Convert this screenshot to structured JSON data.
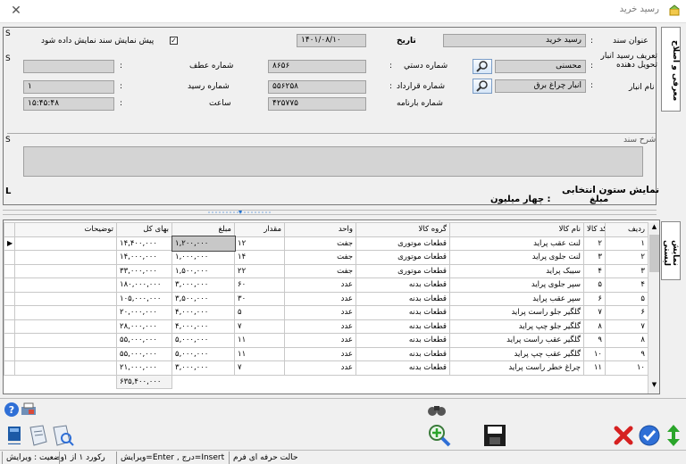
{
  "window": {
    "title": "رسید خرید",
    "close_glyph": "✕"
  },
  "header": {
    "sanad_title_label": "عنوان سند",
    "sanad_title_value": "رسید خرید",
    "date_label": "تاریخ",
    "date_value": "۱۴۰۱/۰۸/۱۰",
    "preview_checkbox_label": "پیش نمایش سند نمایش داده شود",
    "definition_label": "تعریف رسید انبار تحویل دهنده",
    "definition_value": "محسنی",
    "manual_no_label": "شماره دستي",
    "manual_no_value": "۸۶۵۶",
    "atf_no_label": "شماره عطف",
    "atf_no_value": "",
    "warehouse_label": "نام انبار",
    "warehouse_value": "انبار چراغ برق",
    "contract_no_label": "شماره قرارداد",
    "contract_no_value": "۵۵۶۲۵۸",
    "receipt_no_label": "شماره رسید",
    "receipt_no_value": "۱",
    "waybill_no_label": "شماره بارنامه",
    "waybill_no_value": "۴۲۵۷۷۵",
    "time_label": "ساعت",
    "time_value": "۱۵:۴۵:۴۸",
    "colon": ":",
    "description_label": "شرح سند",
    "description_value": "",
    "marker_s": "S",
    "marker_l": "L",
    "show_columns_label": "نمایش ستون انتخابی",
    "amount_label": "مبلغ",
    "amount_value": ": چهار میلیون",
    "tab_label": "معرفی و اصلاح"
  },
  "side_tab_grid": "نمایش لیستی",
  "grid": {
    "columns": [
      "ردیف",
      "کد کالا",
      "نام کالا",
      "گروه کالا",
      "واحد",
      "مقدار",
      "مبلغ",
      "بهای کل",
      "توضیحات"
    ],
    "rows": [
      [
        "۱",
        "۲",
        "لنت عقب پراید",
        "قطعات موتوری",
        "جفت",
        "۱۲",
        "۱,۲۰۰,۰۰۰",
        "۱۴,۴۰۰,۰۰۰",
        ""
      ],
      [
        "۲",
        "۳",
        "لنت جلوی پراید",
        "قطعات موتوری",
        "جفت",
        "۱۴",
        "۱,۰۰۰,۰۰۰",
        "۱۴,۰۰۰,۰۰۰",
        ""
      ],
      [
        "۳",
        "۴",
        "سیبک پراید",
        "قطعات موتوری",
        "جفت",
        "۲۲",
        "۱,۵۰۰,۰۰۰",
        "۳۳,۰۰۰,۰۰۰",
        ""
      ],
      [
        "۴",
        "۵",
        "سپر جلوی پراید",
        "قطعات بدنه",
        "عدد",
        "۶۰",
        "۳,۰۰۰,۰۰۰",
        "۱۸۰,۰۰۰,۰۰۰",
        ""
      ],
      [
        "۵",
        "۶",
        "سپر عقب پراید",
        "قطعات بدنه",
        "عدد",
        "۳۰",
        "۳,۵۰۰,۰۰۰",
        "۱۰۵,۰۰۰,۰۰۰",
        ""
      ],
      [
        "۶",
        "۷",
        "گلگیر جلو راست پراید",
        "قطعات بدنه",
        "عدد",
        "۵",
        "۴,۰۰۰,۰۰۰",
        "۲۰,۰۰۰,۰۰۰",
        ""
      ],
      [
        "۷",
        "۸",
        "گلگیر جلو چپ پراید",
        "قطعات بدنه",
        "عدد",
        "۷",
        "۴,۰۰۰,۰۰۰",
        "۲۸,۰۰۰,۰۰۰",
        ""
      ],
      [
        "۸",
        "۹",
        "گلگیر عقب راست پراید",
        "قطعات بدنه",
        "عدد",
        "۱۱",
        "۵,۰۰۰,۰۰۰",
        "۵۵,۰۰۰,۰۰۰",
        ""
      ],
      [
        "۹",
        "۱۰",
        "گلگیر عقب چپ پراید",
        "قطعات بدنه",
        "عدد",
        "۱۱",
        "۵,۰۰۰,۰۰۰",
        "۵۵,۰۰۰,۰۰۰",
        ""
      ],
      [
        "۱۰",
        "۱۱",
        "چراغ خطر راست پراید",
        "قطعات بدنه",
        "عدد",
        "۷",
        "۳,۰۰۰,۰۰۰",
        "۲۱,۰۰۰,۰۰۰",
        ""
      ]
    ],
    "total": "۶۳۵,۴۰۰,۰۰۰"
  },
  "status": {
    "state": "وضعیت : ویرایش",
    "record": "رکورد ۱ از ۱",
    "keys": "Insert=درج , Enter=ویرایش",
    "mode": "حالت حرفه ای فرم"
  },
  "colors": {
    "accent": "#1e6fd0",
    "panel": "#f0f0f0",
    "field": "#d4d4d4"
  }
}
